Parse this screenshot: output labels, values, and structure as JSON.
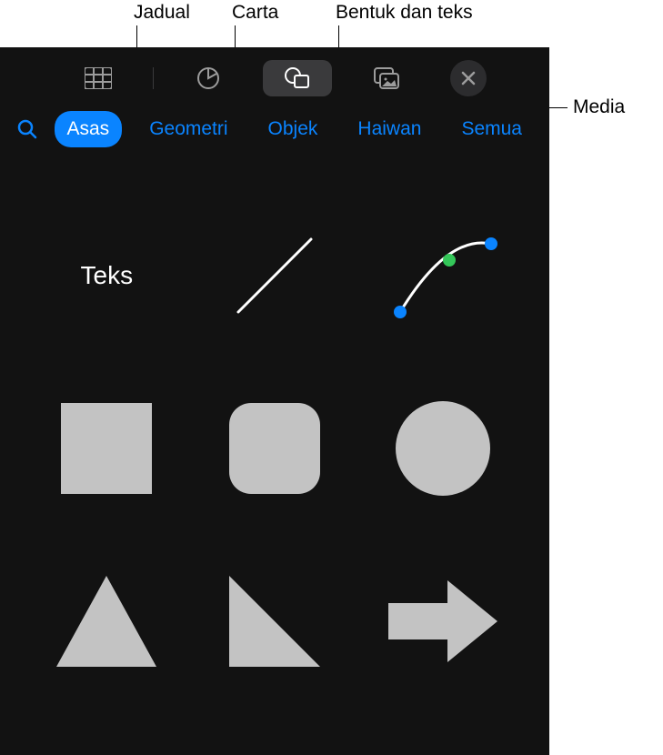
{
  "callouts": {
    "table": "Jadual",
    "chart": "Carta",
    "shapes_text": "Bentuk dan teks",
    "media": "Media"
  },
  "toolbar": {
    "table_icon": "table-icon",
    "chart_icon": "chart-icon",
    "shapes_icon": "shapes-icon",
    "media_icon": "media-icon",
    "close_icon": "close-icon"
  },
  "tabs": {
    "search_icon": "search-icon",
    "items": [
      {
        "label": "Asas",
        "active": true
      },
      {
        "label": "Geometri",
        "active": false
      },
      {
        "label": "Objek",
        "active": false
      },
      {
        "label": "Haiwan",
        "active": false
      },
      {
        "label": "Semua",
        "active": false
      }
    ]
  },
  "shapes": {
    "text_label": "Teks",
    "items": [
      "text",
      "line",
      "curve",
      "square",
      "rounded-square",
      "circle",
      "triangle",
      "right-triangle",
      "arrow-right"
    ]
  }
}
